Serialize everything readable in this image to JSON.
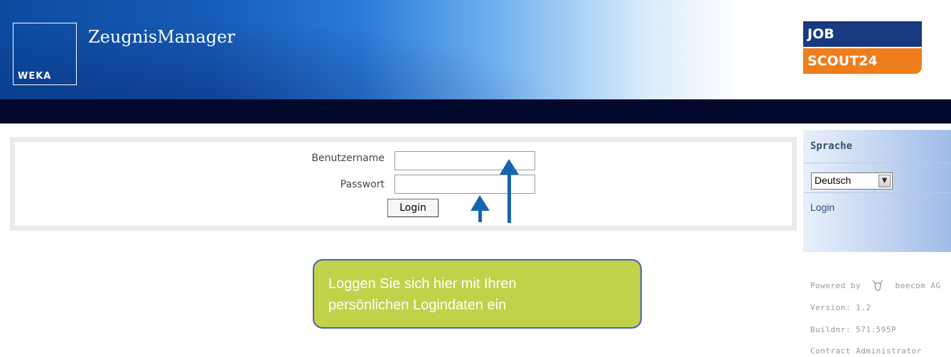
{
  "header": {
    "brand_logo_text": "WEKA",
    "app_title": "ZeugnisManager",
    "partner_logo_line1": "JOB",
    "partner_logo_line2": "SCOUT24"
  },
  "login_form": {
    "username_label": "Benutzername",
    "password_label": "Passwort",
    "username_value": "",
    "password_value": "",
    "login_button": "Login"
  },
  "callout": {
    "line1": "Loggen Sie sich hier mit Ihren",
    "line2": "persönlichen Logindaten ein"
  },
  "sidebar": {
    "section_title": "Sprache",
    "language_selected": "Deutsch",
    "login_link": "Login"
  },
  "footer": {
    "powered_by": "Powered by",
    "company": "beecom AG",
    "version": "Version: 1.2",
    "build": "Buildnr: 571:595P",
    "role": "Contract Administrator"
  },
  "colors": {
    "header_dark": "#0c4a9e",
    "navbar": "#05082d",
    "callout_bg": "#bfd24a",
    "callout_border": "#4560c0",
    "arrow": "#1464b4",
    "jobscout_blue": "#173a80",
    "jobscout_orange": "#f07d1c"
  }
}
